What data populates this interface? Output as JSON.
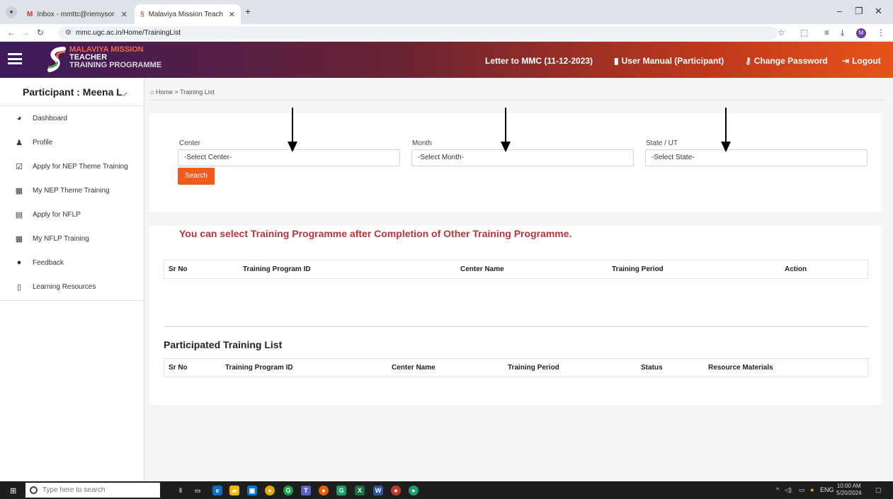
{
  "browser": {
    "tabs": [
      {
        "title": "Inbox - mmttc@riemysore.ac.in",
        "favicon": "gmail-icon"
      },
      {
        "title": "Malaviya Mission Teacher Traini",
        "favicon": "site-icon"
      }
    ],
    "url": "mmc.ugc.ac.in/Home/TrainingList"
  },
  "header": {
    "logo": {
      "line1": "MALAVIYA MISSION",
      "line2": "TEACHER",
      "line3": "TRAINING PROGRAMME"
    },
    "links": [
      {
        "label": "Letter to MMC (11-12-2023)"
      },
      {
        "label": "User Manual (Participant)",
        "icon": "book-icon"
      },
      {
        "label": "Change Password",
        "icon": "key-icon"
      },
      {
        "label": "Logout",
        "icon": "logout-icon"
      }
    ]
  },
  "sidebar": {
    "participant_label": "Participant : Meena L",
    "participant_tail": "&#x1F5F2;",
    "items": [
      {
        "label": "Dashboard",
        "icon": "dashboard-icon"
      },
      {
        "label": "Profile",
        "icon": "user-icon"
      },
      {
        "label": "Apply for NEP Theme Training",
        "icon": "calendar-check-icon"
      },
      {
        "label": "My NEP Theme Training",
        "icon": "grid-icon"
      },
      {
        "label": "Apply for NFLP",
        "icon": "calendar-icon"
      },
      {
        "label": "My NFLP Training",
        "icon": "grid-icon"
      },
      {
        "label": "Feedback",
        "icon": "comment-icon"
      },
      {
        "label": "Learning Resources",
        "icon": "book-icon"
      }
    ]
  },
  "breadcrumb": {
    "home": "Home",
    "separator": ">",
    "current": "Training List"
  },
  "filters": {
    "center": {
      "label": "Center",
      "value": "-Select Center-"
    },
    "month": {
      "label": "Month",
      "value": "-Select Month-"
    },
    "state": {
      "label": "State / UT",
      "value": "-Select State-"
    },
    "search_label": "Search"
  },
  "notice": "You can select Training Programme after Completion of Other Training Programme.",
  "available_table": {
    "columns": [
      "Sr No",
      "Training Program ID",
      "Center Name",
      "Training Period",
      "Action"
    ]
  },
  "participated": {
    "title": "Participated Training List",
    "columns": [
      "Sr No",
      "Training Program ID",
      "Center Name",
      "Training Period",
      "Status",
      "Resource Materials"
    ]
  },
  "taskbar": {
    "search_placeholder": "Type here to search",
    "lang": "ENG",
    "time": "10:00 AM",
    "date": "5/20/2024"
  },
  "colors": {
    "accent": "#f35b1d",
    "notice": "#b7343d"
  }
}
